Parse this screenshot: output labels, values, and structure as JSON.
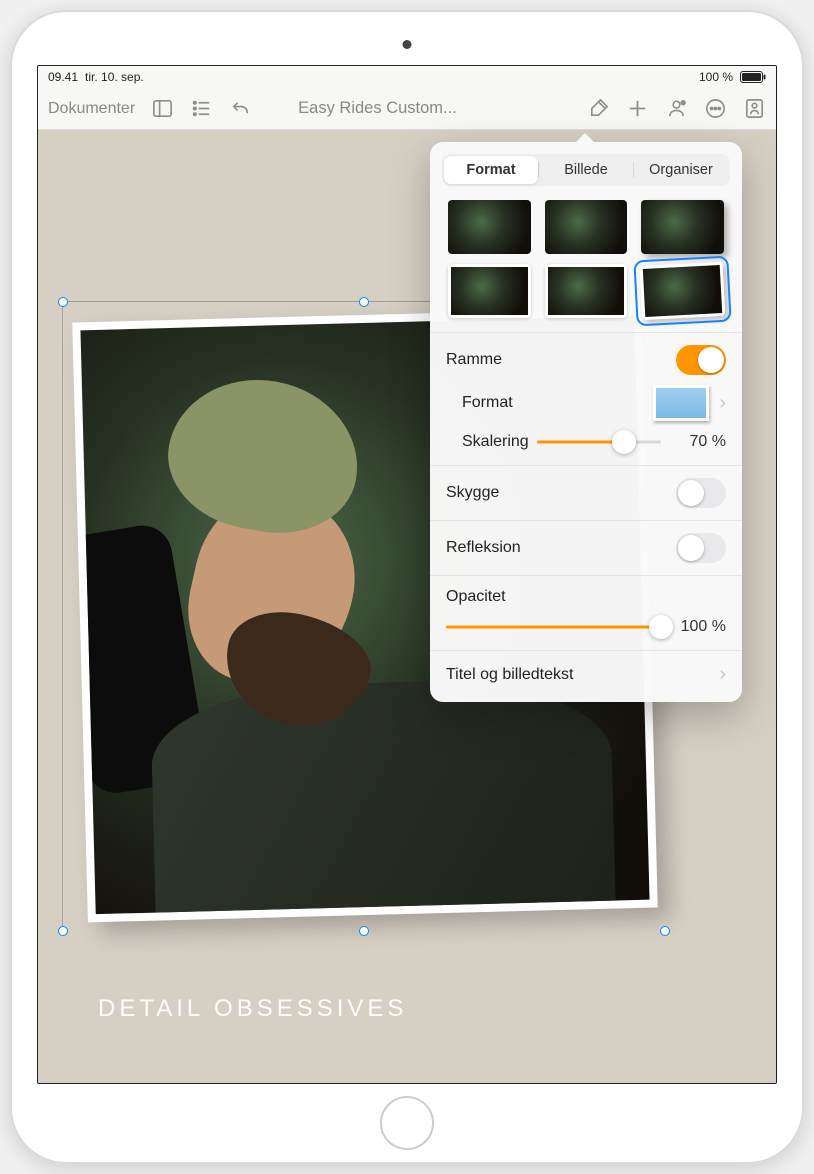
{
  "status": {
    "time": "09.41",
    "date": "tir. 10. sep.",
    "battery_pct": "100 %"
  },
  "toolbar": {
    "back_label": "Dokumenter",
    "title": "Easy Rides Custom..."
  },
  "canvas": {
    "caption": "DETAIL OBSESSIVES"
  },
  "popover": {
    "tabs": {
      "format": "Format",
      "image": "Billede",
      "organize": "Organiser"
    },
    "frame_label": "Ramme",
    "frame_on": true,
    "format_label": "Format",
    "scale_label": "Skalering",
    "scale_value": "70 %",
    "scale_pct": 70,
    "shadow_label": "Skygge",
    "shadow_on": false,
    "reflection_label": "Refleksion",
    "reflection_on": false,
    "opacity_label": "Opacitet",
    "opacity_value": "100 %",
    "opacity_pct": 100,
    "caption_label": "Titel og billedtekst"
  }
}
